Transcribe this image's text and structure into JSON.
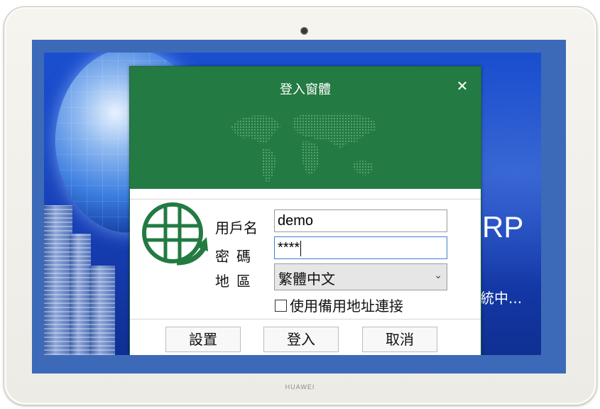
{
  "device": {
    "brand": "HUAWEI"
  },
  "background": {
    "erp_label": "RP",
    "loading_text": "系統中..."
  },
  "dialog": {
    "title": "登入窗體",
    "close_glyph": "✕",
    "fields": {
      "username_label": "用戶名",
      "username_value": "demo",
      "password_label": "密碼",
      "password_value": "****",
      "region_label": "地區",
      "region_value": "繁體中文",
      "backup_address_label": "使用備用地址連接"
    },
    "buttons": {
      "settings": "設置",
      "login": "登入",
      "cancel": "取消"
    }
  },
  "colors": {
    "header_green": "#237a42",
    "screen_blue": "#1a4fd0"
  }
}
